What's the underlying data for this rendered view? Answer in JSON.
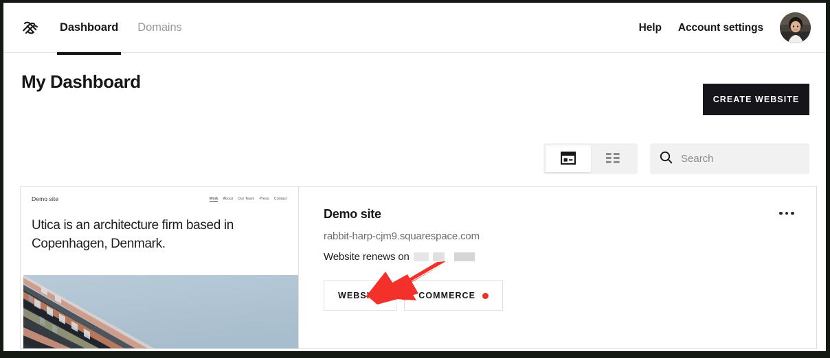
{
  "topbar": {
    "logo_icon": "squarespace-logo-icon",
    "tabs": [
      {
        "label": "Dashboard",
        "active": true
      },
      {
        "label": "Domains",
        "active": false
      }
    ],
    "links": [
      {
        "label": "Help"
      },
      {
        "label": "Account settings"
      }
    ],
    "avatar_icon": "user-avatar-photo"
  },
  "heading": {
    "title": "My Dashboard",
    "create_button": "CREATE WEBSITE"
  },
  "controls": {
    "view_toggle": [
      {
        "icon": "grid-view-icon",
        "active": true
      },
      {
        "icon": "list-view-icon",
        "active": false
      }
    ],
    "search": {
      "icon": "search-icon",
      "placeholder": "Search",
      "value": ""
    }
  },
  "site_card": {
    "preview": {
      "site_name": "Demo site",
      "nav": [
        "Work",
        "About",
        "Our Team",
        "Press",
        "Contact"
      ],
      "current_nav": "Work",
      "headline": "Utica is an architecture firm based in Copenhagen, Denmark.",
      "photo_alt": "architecture-photo"
    },
    "title": "Demo site",
    "url": "rabbit-harp-cjm9.squarespace.com",
    "renew_label": "Website renews on",
    "renew_value_redacted": true,
    "actions": [
      {
        "label": "WEBSITE",
        "badge": false
      },
      {
        "label": "COMMERCE",
        "badge": true
      }
    ],
    "menu_icon": "more-options-icon"
  },
  "annotation": {
    "arrow_icon": "red-arrow-pointer",
    "arrow_color": "#f3302a",
    "points_to": "WEBSITE"
  },
  "colors": {
    "accent_dark": "#16161a",
    "badge_red": "#e8322a",
    "annotation_red": "#f3302a",
    "field_grey": "#f1f1f1",
    "border_grey": "#e0e0e0",
    "muted_text": "#6d6d6d"
  }
}
